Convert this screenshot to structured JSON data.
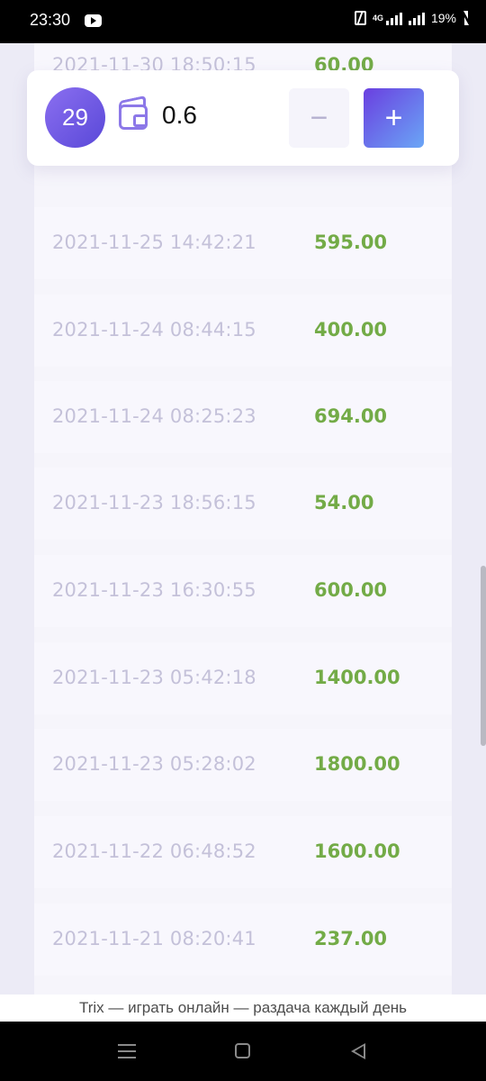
{
  "status_bar": {
    "time": "23:30",
    "app_icon": "youtube-icon",
    "network_label": "4G",
    "battery": "19%"
  },
  "card": {
    "level": "29",
    "wallet_icon": "wallet-icon",
    "balance": "0.6",
    "minus_label": "−",
    "plus_label": "+"
  },
  "transactions": [
    {
      "date": "2021-11-30 18:50:15",
      "amount": "60.00"
    },
    {
      "date": "2021-11-25 14:42:21",
      "amount": "595.00"
    },
    {
      "date": "2021-11-24 08:44:15",
      "amount": "400.00"
    },
    {
      "date": "2021-11-24 08:25:23",
      "amount": "694.00"
    },
    {
      "date": "2021-11-23 18:56:15",
      "amount": "54.00"
    },
    {
      "date": "2021-11-23 16:30:55",
      "amount": "600.00"
    },
    {
      "date": "2021-11-23 05:42:18",
      "amount": "1400.00"
    },
    {
      "date": "2021-11-23 05:28:02",
      "amount": "1800.00"
    },
    {
      "date": "2021-11-22 06:48:52",
      "amount": "1600.00"
    },
    {
      "date": "2021-11-21 08:20:41",
      "amount": "237.00"
    }
  ],
  "page_title": "Trix — играть онлайн — раздача каждый день",
  "colors": {
    "amount": "#73ab47",
    "date": "#c4c1d9",
    "accent_start": "#6a3fe0",
    "accent_end": "#6aa6f6",
    "badge": "#6f5ae4"
  }
}
